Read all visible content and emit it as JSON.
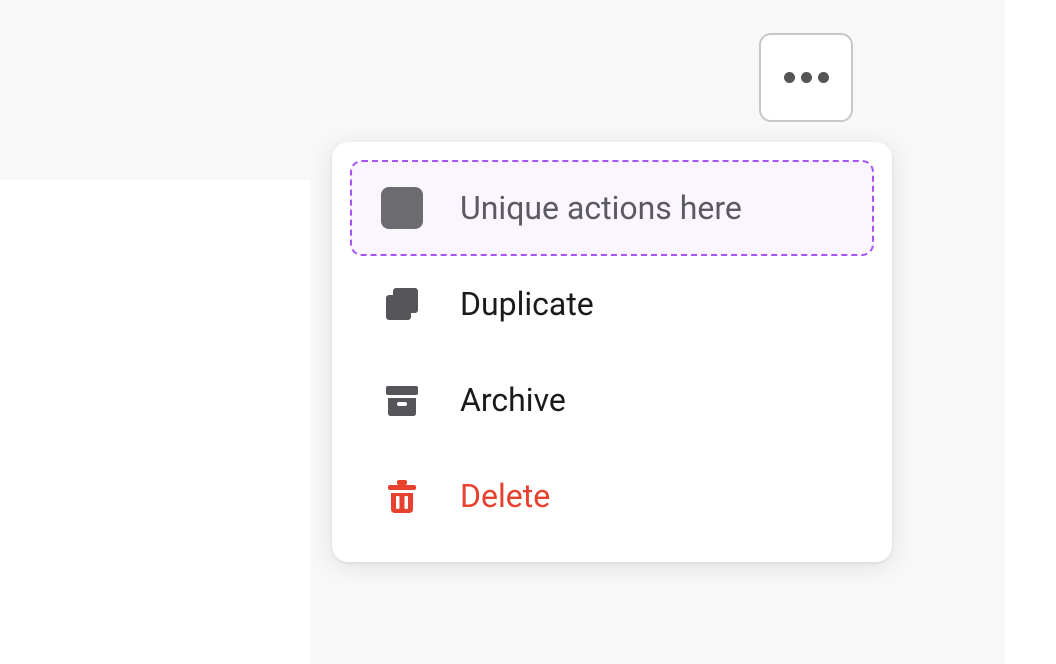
{
  "menu": {
    "items": [
      {
        "label": "Unique actions here",
        "highlighted": true,
        "danger": false
      },
      {
        "label": "Duplicate",
        "highlighted": false,
        "danger": false
      },
      {
        "label": "Archive",
        "highlighted": false,
        "danger": false
      },
      {
        "label": "Delete",
        "highlighted": false,
        "danger": true
      }
    ]
  }
}
